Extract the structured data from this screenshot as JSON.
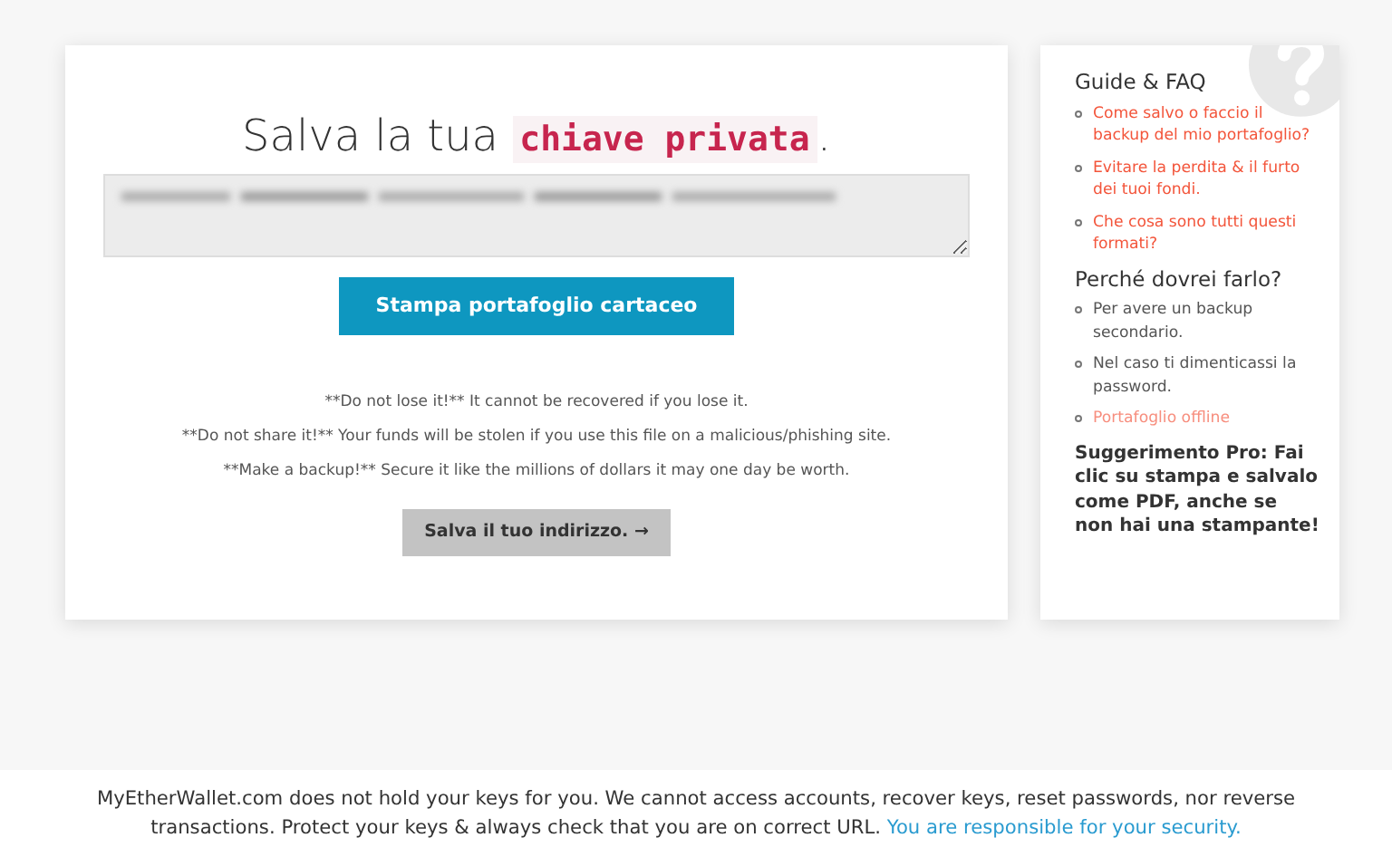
{
  "main": {
    "title_prefix": "Salva la tua",
    "title_code": "chiave privata",
    "title_suffix": ".",
    "print_button": "Stampa portafoglio cartaceo",
    "warnings": [
      "**Do not lose it!** It cannot be recovered if you lose it.",
      "**Do not share it!** Your funds will be stolen if you use this file on a malicious/phishing site.",
      "**Make a backup!** Secure it like the millions of dollars it may one day be worth."
    ],
    "next_button": "Salva il tuo indirizzo. →"
  },
  "sidebar": {
    "sections": [
      {
        "heading": "Guide & FAQ",
        "items": [
          {
            "kind": "link",
            "text": "Come salvo o faccio il backup del mio portafoglio?"
          },
          {
            "kind": "link",
            "text": "Evitare la perdita & il furto dei tuoi fondi."
          },
          {
            "kind": "link",
            "text": "Che cosa sono tutti questi formati?"
          }
        ]
      },
      {
        "heading": "Perché dovrei farlo?",
        "items": [
          {
            "kind": "text",
            "text": "Per avere un backup secondario."
          },
          {
            "kind": "text",
            "text": "Nel caso ti dimenticassi la password."
          },
          {
            "kind": "link",
            "text": "Portafoglio offline"
          }
        ]
      }
    ],
    "tip": "Suggerimento Pro: Fai clic su stampa e salvalo come PDF, anche se non hai una stampante!"
  },
  "footer": {
    "text": "MyEtherWallet.com does not hold your keys for you. We cannot access accounts, recover keys, reset passwords, nor reverse transactions. Protect your keys & always check that you are on correct URL.",
    "link": "You are responsible for your security."
  }
}
